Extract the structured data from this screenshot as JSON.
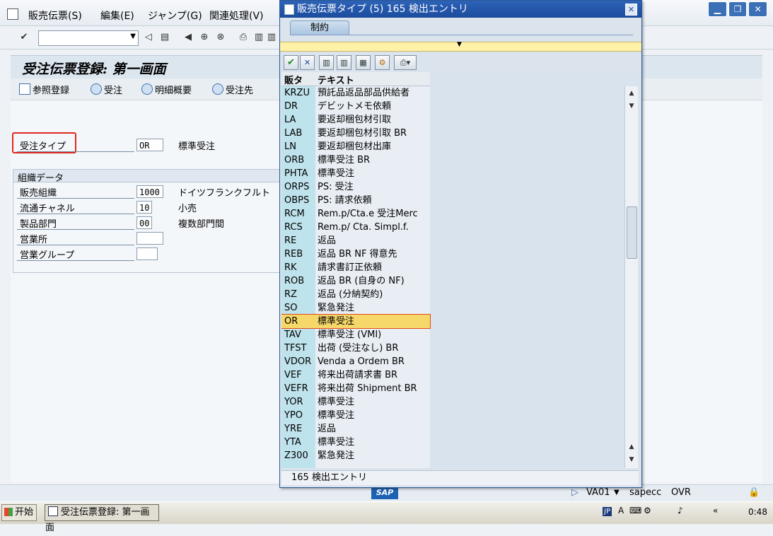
{
  "menu": {
    "items": [
      "販売伝票(S)",
      "編集(E)",
      "ジャンプ(G)",
      "関連処理(V)"
    ]
  },
  "main": {
    "title": "受注伝票登録: 第一画面",
    "app_buttons": [
      "参照登録",
      "受注",
      "明細概要",
      "受注先"
    ],
    "order_type": {
      "label": "受注タイプ",
      "value": "OR",
      "desc": "標準受注"
    },
    "group": {
      "title": "組織データ",
      "fields": [
        {
          "label": "販売組織",
          "value": "1000",
          "desc": "ドイツフランクフルト"
        },
        {
          "label": "流通チャネル",
          "value": "10",
          "desc": "小売"
        },
        {
          "label": "製品部門",
          "value": "00",
          "desc": "複数部門間"
        },
        {
          "label": "営業所",
          "value": "",
          "desc": ""
        },
        {
          "label": "営業グループ",
          "value": "",
          "desc": ""
        }
      ]
    }
  },
  "popup": {
    "title": "販売伝票タイプ (5)   165  検出エントリ",
    "tab": "制約",
    "columns": [
      "販タ",
      "テキスト"
    ],
    "rows": [
      {
        "k": "KRZU",
        "t": "預託品返品部品供給者"
      },
      {
        "k": "DR",
        "t": "デビットメモ依頼"
      },
      {
        "k": "LA",
        "t": "要返却梱包材引取"
      },
      {
        "k": "LAB",
        "t": "要返却梱包材引取 BR"
      },
      {
        "k": "LN",
        "t": "要返却梱包材出庫"
      },
      {
        "k": "ORB",
        "t": "標準受注 BR"
      },
      {
        "k": "PHTA",
        "t": "標準受注"
      },
      {
        "k": "ORPS",
        "t": "PS: 受注"
      },
      {
        "k": "OBPS",
        "t": "PS: 請求依頼"
      },
      {
        "k": "RCM",
        "t": "Rem.p/Cta.e 受注Merc"
      },
      {
        "k": "RCS",
        "t": "Rem.p/ Cta. Simpl.f."
      },
      {
        "k": "RE",
        "t": "返品"
      },
      {
        "k": "REB",
        "t": "返品 BR NF 得意先"
      },
      {
        "k": "RK",
        "t": "請求書訂正依頼"
      },
      {
        "k": "ROB",
        "t": "返品 BR (自身の NF)"
      },
      {
        "k": "RZ",
        "t": "返品 (分納契約)"
      },
      {
        "k": "SO",
        "t": "緊急発注"
      },
      {
        "k": "OR",
        "t": "標準受注",
        "selected": true
      },
      {
        "k": "TAV",
        "t": "標準受注 (VMI)"
      },
      {
        "k": "TFST",
        "t": "出荷 (受注なし) BR"
      },
      {
        "k": "VDOR",
        "t": "Venda a Ordem BR"
      },
      {
        "k": "VEF",
        "t": "将来出荷請求書 BR"
      },
      {
        "k": "VEFR",
        "t": "将来出荷 Shipment BR"
      },
      {
        "k": "YOR",
        "t": "標準受注"
      },
      {
        "k": "YPO",
        "t": "標準受注"
      },
      {
        "k": "YRE",
        "t": "返品"
      },
      {
        "k": "YTA",
        "t": "標準受注"
      },
      {
        "k": "Z300",
        "t": "緊急発注"
      }
    ],
    "status": "165 検出エントリ"
  },
  "statusbar": {
    "logo": "SAP",
    "tcode": "VA01",
    "server": "sapecc",
    "mode": "OVR"
  },
  "taskbar": {
    "start": "开始",
    "item": "受注伝票登録: 第一画面",
    "tray_lang": "JP",
    "tray_time": "0:48"
  },
  "colors": {
    "accent": "#1b4c9e",
    "highlight": "#f6d86a",
    "redbox": "#e0281e"
  }
}
